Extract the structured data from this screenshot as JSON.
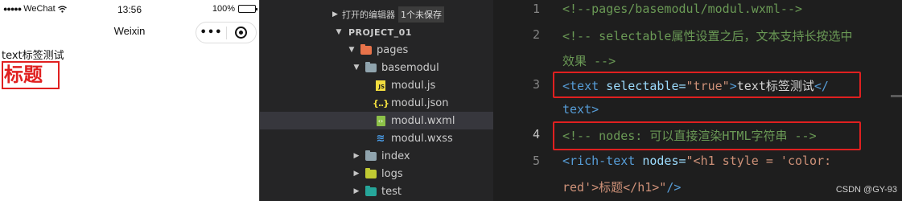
{
  "simulator": {
    "status": {
      "signal": "●●●●●",
      "carrier": "WeChat",
      "time": "13:56",
      "battery": "100%",
      "battery_level": 1.0
    },
    "nav_title": "Weixin",
    "capsule_more": "•••",
    "content": {
      "text_line": "text标签测试",
      "heading": "标题"
    }
  },
  "explorer": {
    "open_editors_label": "打开的编辑器",
    "unsaved_badge": "1个未保存",
    "project_label": "PROJECT_01",
    "tree": [
      {
        "label": "pages",
        "type": "folder",
        "expanded": true,
        "icon": "pages-folder-icon",
        "color": "#e8734a"
      },
      {
        "label": "basemodul",
        "type": "folder",
        "expanded": true,
        "icon": "folder-open-icon",
        "color": "#90a4ae"
      },
      {
        "label": "modul.js",
        "type": "file",
        "icon": "js-file-icon"
      },
      {
        "label": "modul.json",
        "type": "file",
        "icon": "json-file-icon"
      },
      {
        "label": "modul.wxml",
        "type": "file",
        "icon": "wxml-file-icon",
        "selected": true
      },
      {
        "label": "modul.wxss",
        "type": "file",
        "icon": "wxss-file-icon"
      },
      {
        "label": "index",
        "type": "folder",
        "expanded": false,
        "icon": "folder-icon",
        "color": "#90a4ae"
      },
      {
        "label": "logs",
        "type": "folder",
        "expanded": false,
        "icon": "logs-folder-icon",
        "color": "#c0ca33"
      },
      {
        "label": "test",
        "type": "folder",
        "expanded": false,
        "icon": "test-folder-icon",
        "color": "#26a69a"
      }
    ]
  },
  "editor": {
    "line_numbers": [
      "1",
      "2",
      "3",
      "4",
      "5"
    ],
    "lines": {
      "l1": "<!--pages/basemodul/modul.wxml-->",
      "l2a": "<!-- selectable属性设置之后，文本支持长按选中",
      "l2b": "效果 -->",
      "l3_tag_open": "<text",
      "l3_attr": " selectable=",
      "l3_str": "\"true\"",
      "l3_close": ">",
      "l3_text": "text标签测试",
      "l3_end": "</",
      "l3b_tag": "text",
      "l3b_close": ">",
      "l4": "<!-- nodes: 可以直接渲染HTML字符串 -->",
      "l5_tag_open": "<rich-text",
      "l5_attr": " nodes=",
      "l5_str_a": "\"<h1 style = 'color:",
      "l5_str_b": "red'>标题</h1>\"",
      "l5_close": "/>"
    },
    "watermark": "CSDN @GY-93"
  }
}
